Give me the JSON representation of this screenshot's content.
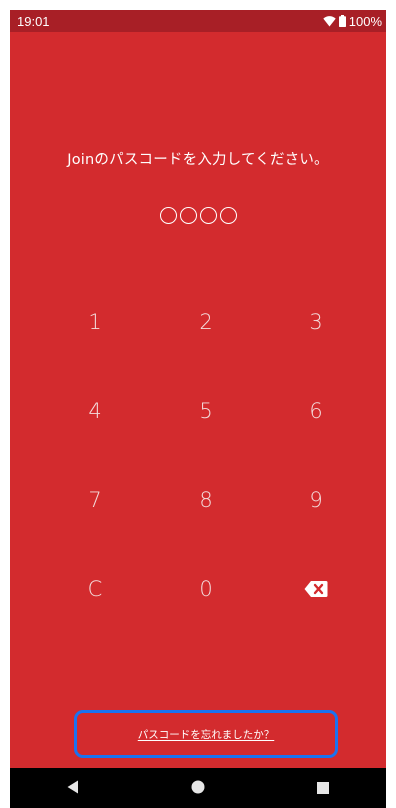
{
  "status_bar": {
    "time": "19:01",
    "battery": "100%",
    "icons": [
      "wifi-icon",
      "battery-icon"
    ]
  },
  "lock_screen": {
    "prompt": "Joinのパスコードを入力してください。",
    "dot_count": 4,
    "keys": [
      {
        "label": "1",
        "name": "key-1"
      },
      {
        "label": "2",
        "name": "key-2"
      },
      {
        "label": "3",
        "name": "key-3"
      },
      {
        "label": "4",
        "name": "key-4"
      },
      {
        "label": "5",
        "name": "key-5"
      },
      {
        "label": "6",
        "name": "key-6"
      },
      {
        "label": "7",
        "name": "key-7"
      },
      {
        "label": "8",
        "name": "key-8"
      },
      {
        "label": "9",
        "name": "key-9"
      },
      {
        "label": "C",
        "name": "key-clear"
      },
      {
        "label": "0",
        "name": "key-0"
      },
      {
        "label": "",
        "name": "backspace-key",
        "icon": "backspace-icon"
      }
    ],
    "forgot_link": "パスコードを忘れましたか？"
  },
  "nav_bar": {
    "icons": [
      "back-icon",
      "home-icon",
      "recents-icon"
    ]
  },
  "colors": {
    "background": "#d32b2e",
    "status_bar": "#a81f26",
    "highlight_border": "#1a73f0",
    "text": "#ffffff"
  }
}
